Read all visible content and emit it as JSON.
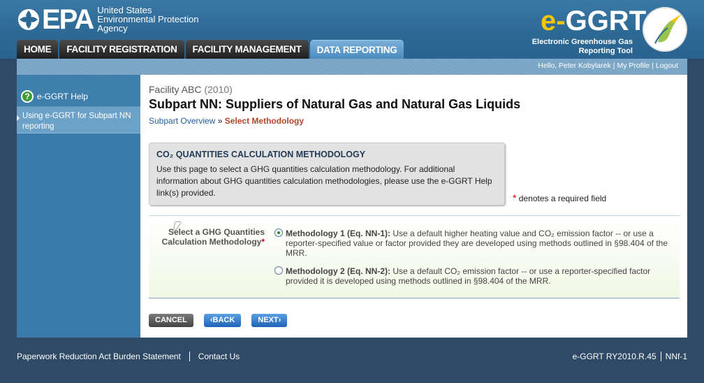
{
  "header": {
    "epa_word": "EPA",
    "agency_lines": [
      "United States",
      "Environmental Protection",
      "Agency"
    ],
    "app_title_e": "e-",
    "app_title_rest": "GGRT",
    "app_subtitle_1": "Electronic Greenhouse Gas",
    "app_subtitle_2": "Reporting Tool"
  },
  "nav": {
    "tabs": [
      "HOME",
      "FACILITY REGISTRATION",
      "FACILITY MANAGEMENT",
      "DATA REPORTING"
    ],
    "active": "DATA REPORTING"
  },
  "userbar": {
    "greeting": "Hello, Peter Kobylarek",
    "profile": "My Profile",
    "logout": "Logout"
  },
  "sidebar": {
    "help": "e-GGRT Help",
    "link": "Using e-GGRT for Subpart NN reporting"
  },
  "page": {
    "facility": "Facility ABC",
    "year": "(2010)",
    "subpart_title": "Subpart NN: Suppliers of Natural Gas and Natural Gas Liquids",
    "breadcrumb_link": "Subpart Overview",
    "breadcrumb_sep": " » ",
    "breadcrumb_current": "Select Methodology"
  },
  "infobox": {
    "title": "CO₂ QUANTITIES CALCULATION METHODOLOGY",
    "text": "Use this page to select a GHG quantities calculation methodology. For additional information about GHG quantities calculation methodologies, please use the e-GGRT Help link(s) provided."
  },
  "required_note": "denotes a required field",
  "form": {
    "label": "Select a GHG Quantities Calculation Methodology",
    "options": [
      {
        "title": "Methodology 1 (Eq. NN-1):",
        "text": " Use a default higher heating value and CO₂ emission factor -- or use a reporter-specified value or factor provided they are developed using methods outlined in §98.404 of the MRR.",
        "selected": true
      },
      {
        "title": "Methodology 2 (Eq. NN-2):",
        "text": " Use a default CO₂ emission factor -- or use a reporter-specified factor provided it is developed using methods outlined in §98.404 of the MRR.",
        "selected": false
      }
    ]
  },
  "buttons": {
    "cancel": "CANCEL",
    "back": "‹BACK",
    "next": "NEXT›"
  },
  "footer": {
    "paperwork": "Paperwork Reduction Act Burden Statement",
    "contact": "Contact Us",
    "version": "e-GGRT RY2010.R.45",
    "page_id": "NNf-1"
  },
  "colors": {
    "header_blue": "#2c6894",
    "sidebar_blue": "#3a7aaa",
    "active_tab": "#4b8bc0",
    "breadcrumb_current": "#b4452a"
  }
}
